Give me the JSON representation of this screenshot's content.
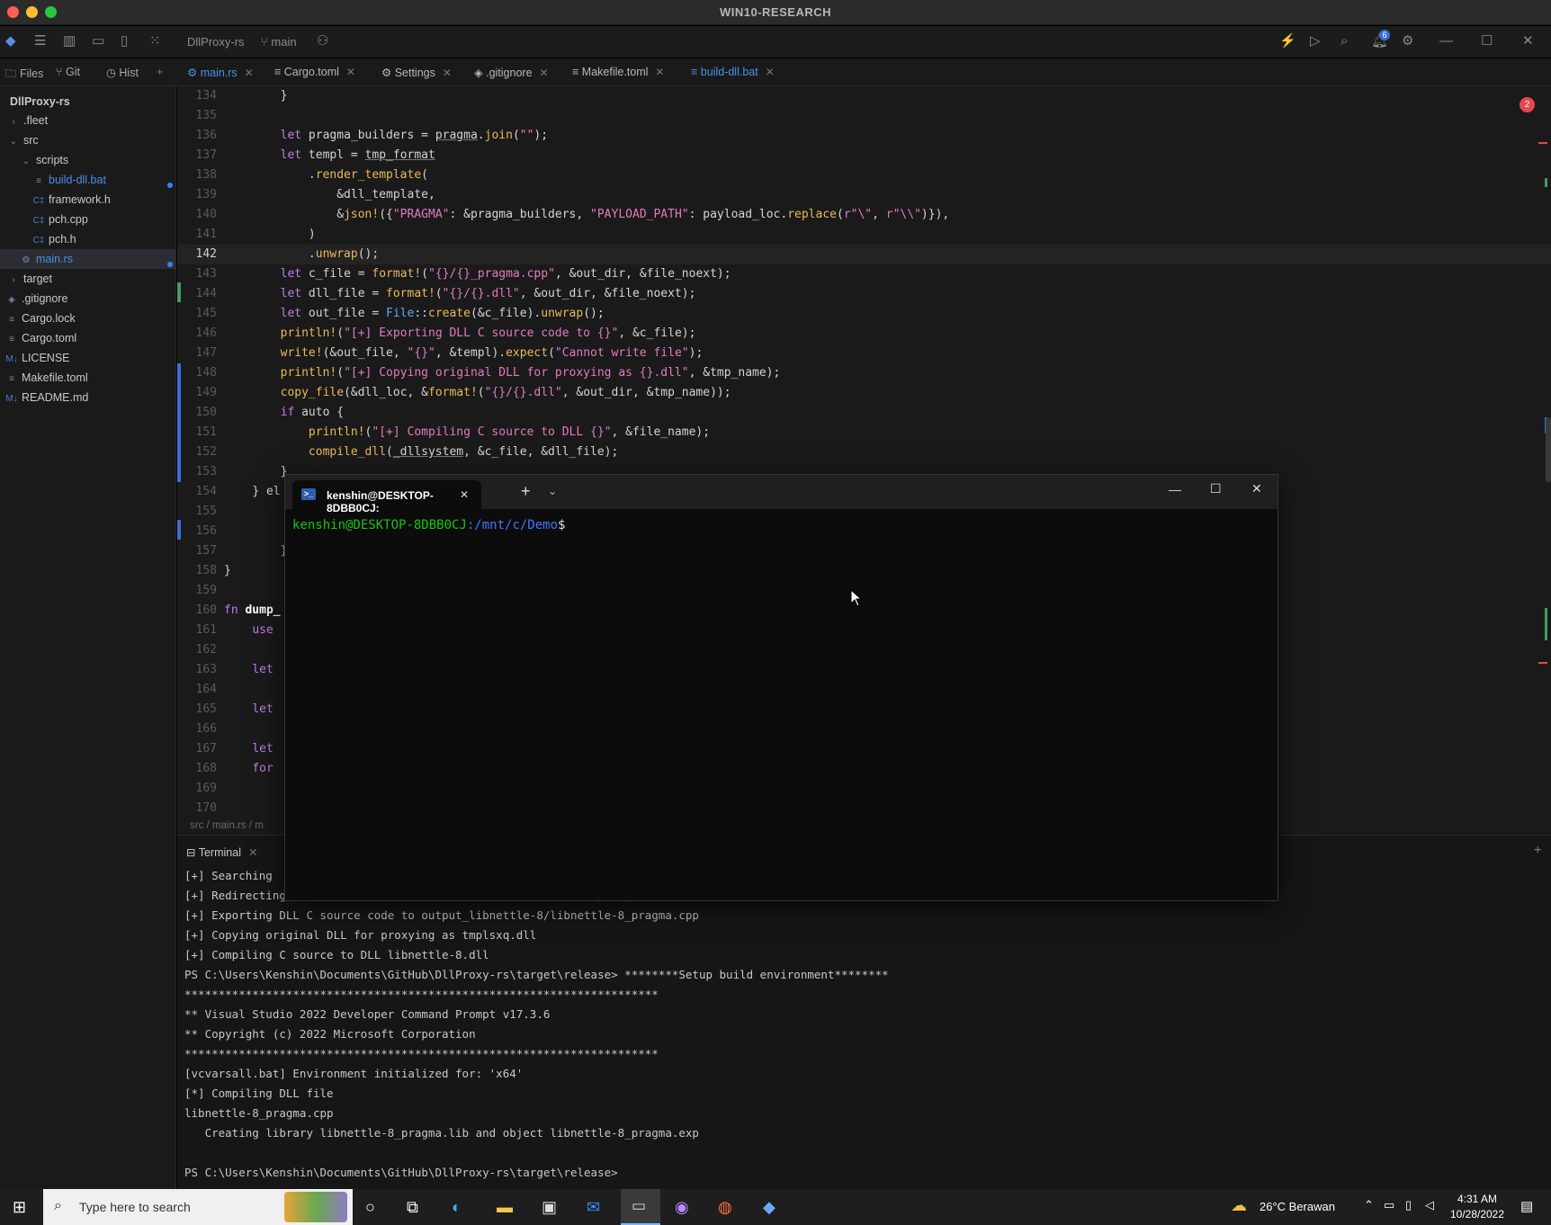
{
  "window": {
    "title": "WIN10-RESEARCH"
  },
  "toolbar": {
    "project": "DllProxy-rs",
    "branch": "main"
  },
  "panel_tabs": [
    "Files",
    "Git",
    "Hist"
  ],
  "file_tabs": [
    {
      "label": "main.rs",
      "active": true
    },
    {
      "label": "Cargo.toml"
    },
    {
      "label": "Settings"
    },
    {
      "label": ".gitignore"
    },
    {
      "label": "Makefile.toml"
    },
    {
      "label": "build-dll.bat"
    }
  ],
  "sidebar": {
    "root": "DllProxy-rs",
    "items": [
      ".fleet",
      "src",
      "scripts",
      "build-dll.bat",
      "framework.h",
      "pch.cpp",
      "pch.h",
      "main.rs",
      "target",
      ".gitignore",
      "Cargo.lock",
      "Cargo.toml",
      "LICENSE",
      "Makefile.toml",
      "README.md"
    ]
  },
  "editor": {
    "line_numbers": [
      "134",
      "135",
      "136",
      "137",
      "138",
      "139",
      "140",
      "141",
      "142",
      "143",
      "144",
      "145",
      "146",
      "147",
      "148",
      "149",
      "150",
      "151",
      "152",
      "153",
      "154",
      "155",
      "156",
      "157",
      "158",
      "159",
      "160",
      "161",
      "162",
      "163",
      "164",
      "165",
      "166",
      "167",
      "168",
      "169",
      "170"
    ],
    "error_count": "2",
    "fragments": {
      "l154": "} el",
      "l160a": "fn ",
      "l160b": "dump_",
      "l161": "use ",
      "l163": "let ",
      "l165": "let ",
      "l167": "let ",
      "l168": "for "
    }
  },
  "breadcrumb": "src  /  main.rs  /  m",
  "bottom_panel": {
    "tab": "Terminal",
    "lines": [
      "[+] Searching",
      "[+] Redirecting 547 function calls from libnettle-8.dll to tmplsxq.dll",
      "[+] Exporting DLL C source code to output_libnettle-8/libnettle-8_pragma.cpp",
      "[+] Copying original DLL for proxying as tmplsxq.dll",
      "[+] Compiling C source to DLL libnettle-8.dll",
      "PS C:\\Users\\Kenshin\\Documents\\GitHub\\DllProxy-rs\\target\\release> ********Setup build environment********",
      "**********************************************************************",
      "** Visual Studio 2022 Developer Command Prompt v17.3.6",
      "** Copyright (c) 2022 Microsoft Corporation",
      "**********************************************************************",
      "[vcvarsall.bat] Environment initialized for: 'x64'",
      "[*] Compiling DLL file",
      "libnettle-8_pragma.cpp",
      "   Creating library libnettle-8_pragma.lib and object libnettle-8_pragma.exp",
      "",
      "PS C:\\Users\\Kenshin\\Documents\\GitHub\\DllProxy-rs\\target\\release>"
    ]
  },
  "windows_terminal": {
    "tab_title": "kenshin@DESKTOP-8DBB0CJ:",
    "prompt_user": "kenshin@DESKTOP-8DBB0CJ",
    "prompt_path": ":/mnt/c/Demo",
    "prompt_symbol": "$"
  },
  "taskbar": {
    "search_placeholder": "Type here to search",
    "weather": "26°C  Berawan",
    "time": "4:31 AM",
    "date": "10/28/2022"
  },
  "notification_badge": "6"
}
